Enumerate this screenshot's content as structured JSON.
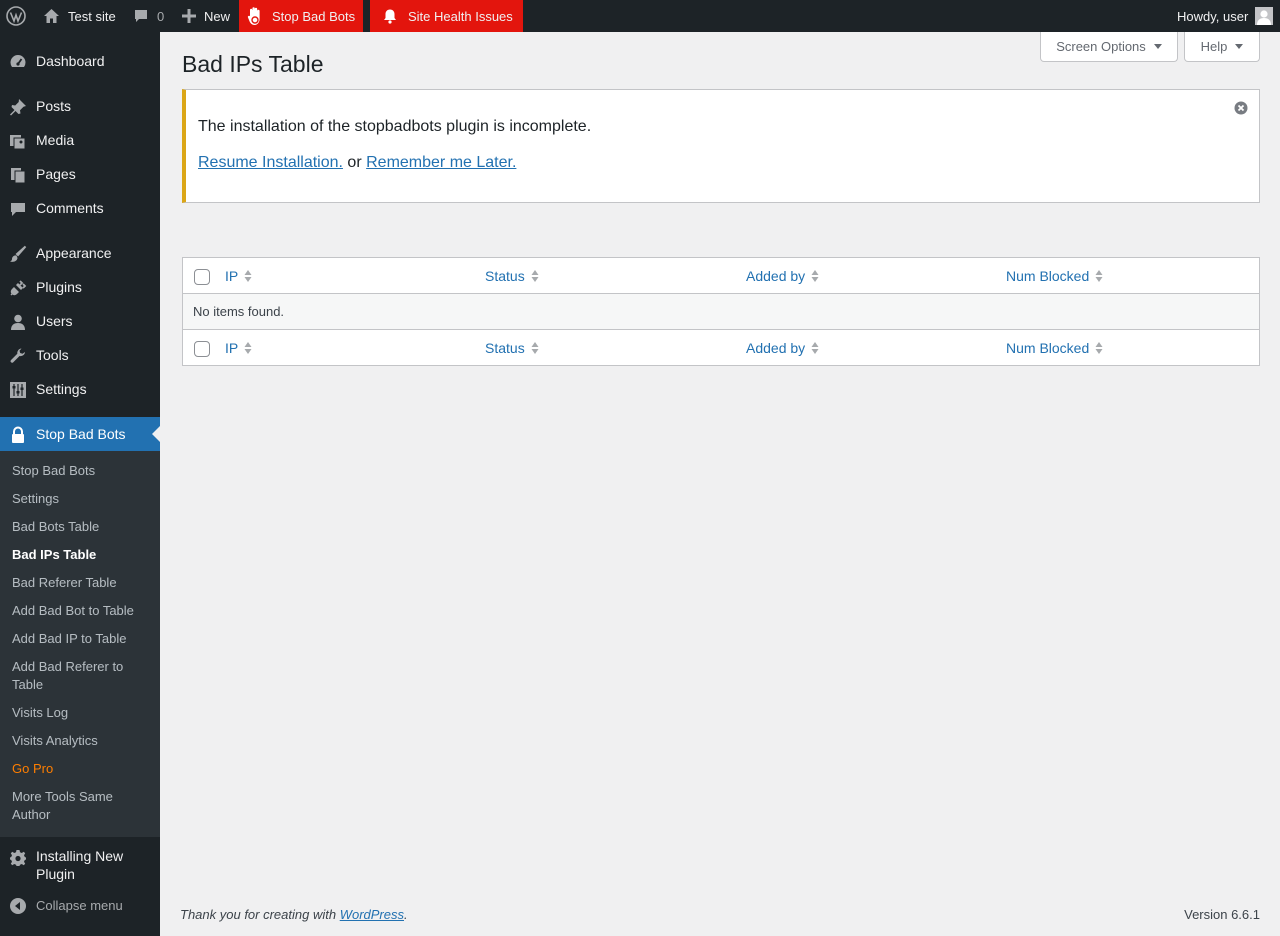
{
  "adminbar": {
    "site_name": "Test site",
    "comments_count": "0",
    "new_label": "New",
    "stop_bad_bots_label": "Stop Bad Bots",
    "site_health_label": "Site Health Issues",
    "howdy": "Howdy, user"
  },
  "sidebar": {
    "items": [
      {
        "label": "Dashboard",
        "icon": "dashboard-icon"
      },
      {
        "label": "Posts",
        "icon": "pin-icon"
      },
      {
        "label": "Media",
        "icon": "media-icon"
      },
      {
        "label": "Pages",
        "icon": "pages-icon"
      },
      {
        "label": "Comments",
        "icon": "comment-icon"
      },
      {
        "label": "Appearance",
        "icon": "brush-icon"
      },
      {
        "label": "Plugins",
        "icon": "plug-icon"
      },
      {
        "label": "Users",
        "icon": "user-icon"
      },
      {
        "label": "Tools",
        "icon": "wrench-icon"
      },
      {
        "label": "Settings",
        "icon": "sliders-icon"
      },
      {
        "label": "Stop Bad Bots",
        "icon": "lock-icon"
      },
      {
        "label": "Installing New Plugin",
        "icon": "gear-icon"
      },
      {
        "label": "Collapse menu",
        "icon": "collapse-icon"
      }
    ],
    "submenu": [
      "Stop Bad Bots",
      "Settings",
      "Bad Bots Table",
      "Bad IPs Table",
      "Bad Referer Table",
      "Add Bad Bot to Table",
      "Add Bad IP to Table",
      "Add Bad Referer to Table",
      "Visits Log",
      "Visits Analytics",
      "Go Pro",
      "More Tools Same Author"
    ]
  },
  "header": {
    "screen_options": "Screen Options",
    "help": "Help",
    "title": "Bad IPs Table"
  },
  "notice": {
    "message": "The installation of the stopbadbots plugin is incomplete.",
    "resume_link": "Resume Installation.",
    "or_text": "or",
    "later_link": "Remember me Later."
  },
  "table": {
    "columns": [
      "IP",
      "Status",
      "Added by",
      "Num Blocked"
    ],
    "empty_message": "No items found."
  },
  "footer": {
    "thanks": "Thank you for creating with",
    "wp_link": "WordPress",
    "period": ".",
    "version": "Version 6.6.1"
  },
  "colors": {
    "adminbar_bg": "#1d2327",
    "accent": "#2271b1",
    "notice_warning": "#dba617",
    "alert_red": "#e3150d",
    "go_pro": "#fe7e00"
  }
}
